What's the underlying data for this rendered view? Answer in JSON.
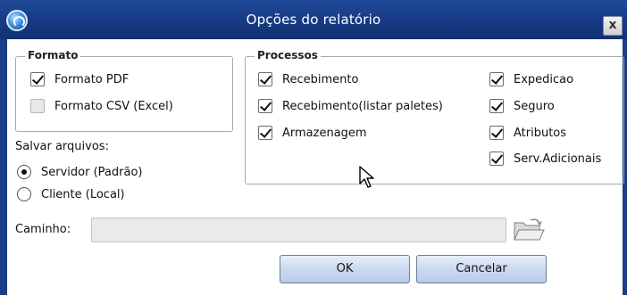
{
  "window": {
    "title": "Opções do relatório",
    "close_label": "x"
  },
  "formato": {
    "legend": "Formato",
    "items": [
      {
        "label": "Formato PDF",
        "checked": true
      },
      {
        "label": "Formato CSV (Excel)",
        "checked": false
      }
    ]
  },
  "salvar": {
    "label": "Salvar arquivos:",
    "options": [
      {
        "label": "Servidor (Padrão)",
        "selected": true
      },
      {
        "label": "Cliente (Local)",
        "selected": false
      }
    ]
  },
  "processos": {
    "legend": "Processos",
    "left": [
      {
        "label": "Recebimento",
        "checked": true
      },
      {
        "label": "Recebimento(listar paletes)",
        "checked": true
      },
      {
        "label": "Armazenagem",
        "checked": true
      }
    ],
    "right": [
      {
        "label": "Expedicao",
        "checked": true
      },
      {
        "label": "Seguro",
        "checked": true
      },
      {
        "label": "Atributos",
        "checked": true
      },
      {
        "label": "Serv.Adicionais",
        "checked": true
      }
    ]
  },
  "caminho": {
    "label": "Caminho:",
    "value": "",
    "browse_icon": "folder-icon"
  },
  "buttons": {
    "ok": "OK",
    "cancel": "Cancelar"
  },
  "colors": {
    "titlebar": "#163a82",
    "button": "#c9d8ee"
  }
}
